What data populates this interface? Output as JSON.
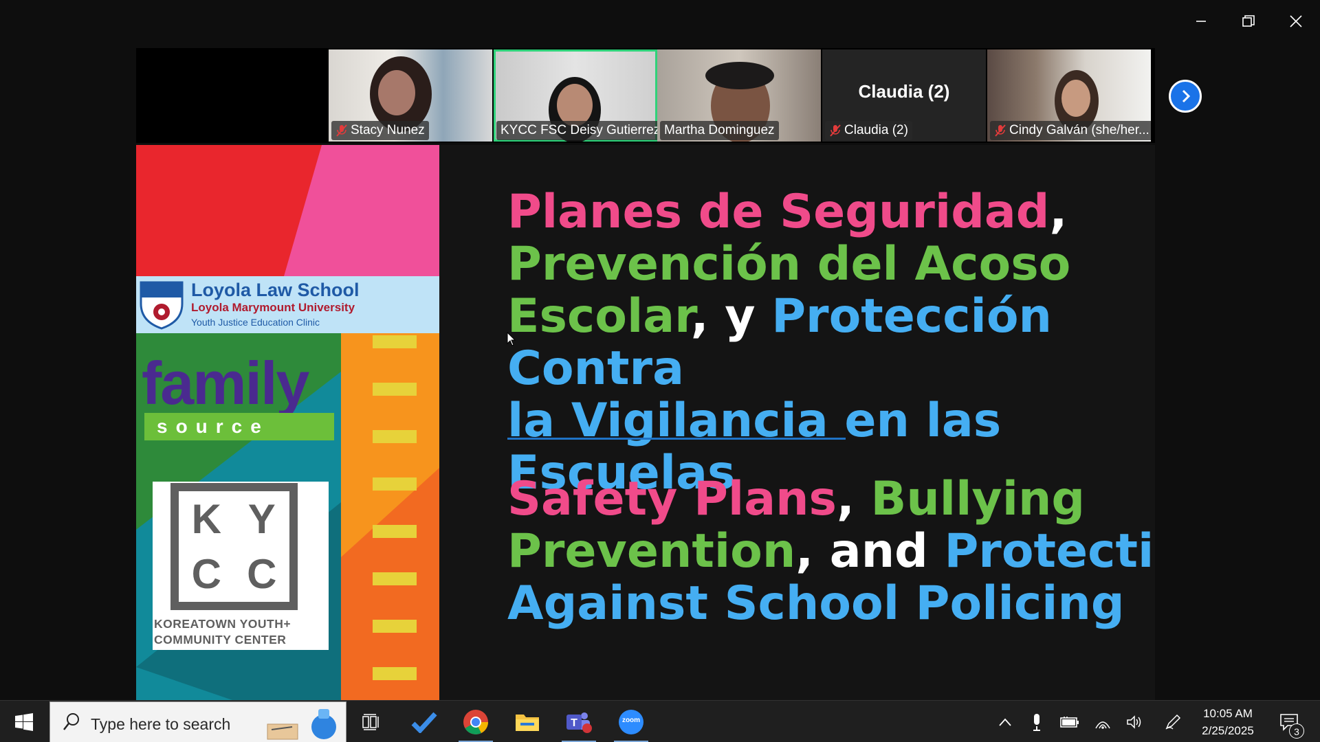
{
  "window": {
    "controls": [
      "minimize",
      "restore",
      "close"
    ]
  },
  "participants": [
    {
      "name": "Stacy Nunez",
      "muted": true
    },
    {
      "name": "KYCC FSC Deisy Gutierrez",
      "muted": false,
      "active_speaker": true
    },
    {
      "name": "Martha Dominguez",
      "muted": false
    },
    {
      "name": "Claudia (2)",
      "muted": true,
      "video_off": true,
      "display_name": "Claudia (2)"
    },
    {
      "name": "Cindy Galván (she/her...",
      "muted": true
    }
  ],
  "slide": {
    "logos": {
      "lls_title": "Loyola Law School",
      "lls_subtitle": "Loyola Marymount University",
      "lls_clinic": "Youth Justice Education Clinic",
      "family_title": "family",
      "family_sub": "source",
      "kycc_letters": [
        "K",
        "Y",
        "C",
        "C"
      ],
      "kycc_caption_line1": "KOREATOWN YOUTH+",
      "kycc_caption_line2": "COMMUNITY CENTER"
    },
    "es": {
      "p1": "Planes de Seguridad",
      "c1": ",",
      "p2": "Prevención del Acoso",
      "p3": "Escolar",
      "c2": ", y ",
      "p4": "Protección Contra",
      "p5": "la Vigilancia en las Escuelas"
    },
    "en": {
      "p1": "Safety Plans",
      "c1": ", ",
      "p2": "Bullying",
      "p3": "Prevention",
      "c2": ", and ",
      "p4": "Protecting",
      "p5": "Against School Policing"
    },
    "colors": {
      "pink": "#f04b8a",
      "green": "#6cc24a",
      "blue": "#45aef2"
    }
  },
  "taskbar": {
    "search_placeholder": "Type here to search",
    "apps": [
      "task-view-icon",
      "todo-icon",
      "chrome-icon",
      "file-explorer-icon",
      "teams-icon",
      "zoom-icon"
    ],
    "zoom_label": "zoom",
    "time": "10:05 AM",
    "date": "2/25/2025",
    "notification_count": "3"
  }
}
